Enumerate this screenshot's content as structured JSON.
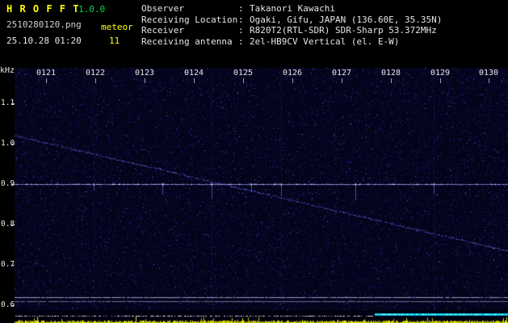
{
  "app": {
    "title": "H R O F F T",
    "version": "1.0.0",
    "filename": "2510280120.png",
    "mode": "meteor",
    "timestamp": "25.10.28 01:20",
    "count": "11"
  },
  "info": {
    "rows": [
      {
        "label": "Observer",
        "value": "Takanori Kawachi"
      },
      {
        "label": "Receiving Location",
        "value": "Ogaki, Gifu, JAPAN (136.60E, 35.35N)"
      },
      {
        "label": "Receiver",
        "value": "R820T2(RTL-SDR) SDR-Sharp 53.372MHz"
      },
      {
        "label": "Receiving antenna",
        "value": "2el-HB9CV Vertical (el. E-W)"
      }
    ]
  },
  "colors": {
    "title_yellow": "#ffff00",
    "version_green": "#00dd44",
    "text_white": "#e6e6e6",
    "carrier_line": "#a2a2e4",
    "noise_blue": "#1e1e72",
    "strip_yellow": "#e6e600",
    "strip_cyan": "#00c0e0"
  },
  "chart_data": {
    "type": "heatmap",
    "title": "Radio meteor echo spectrogram (HROFFT)",
    "ylabel": "kHz",
    "y_ticks": [
      "1.1",
      "1.0",
      "0.9",
      "0.8",
      "0.7",
      "0.6"
    ],
    "y_tick_values": [
      1.1,
      1.0,
      0.9,
      0.8,
      0.7,
      0.6
    ],
    "y_range_khz": [
      0.588,
      1.188
    ],
    "x_ticks": [
      "0121",
      "0122",
      "0123",
      "0124",
      "0125",
      "0126",
      "0127",
      "0128",
      "0129",
      "0130"
    ],
    "carrier_line_khz": 0.9,
    "doppler_trace": {
      "start_x_frac": 0.0,
      "start_khz": 1.02,
      "end_x_frac": 1.0,
      "end_khz": 0.735
    },
    "meteor_echoes_x_frac": [
      0.16,
      0.3,
      0.4,
      0.48,
      0.54,
      0.69,
      0.85
    ],
    "noise_floor_lines_khz": [
      0.62,
      0.61
    ],
    "bottom_band_start_frac": 0.73,
    "grid": false,
    "legend": false
  }
}
